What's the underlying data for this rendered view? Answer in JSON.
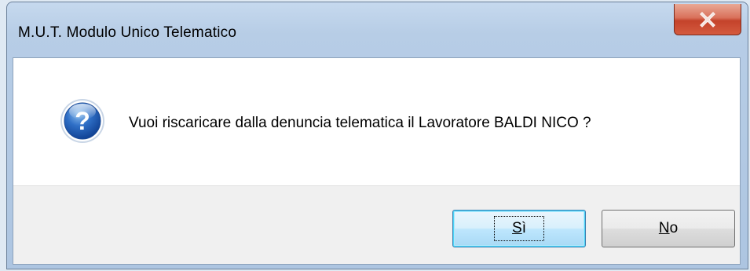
{
  "window": {
    "title": "M.U.T. Modulo Unico Telematico"
  },
  "message": {
    "text": "Vuoi riscaricare dalla denuncia telematica il Lavoratore BALDI NICO ?",
    "icon": "question-icon"
  },
  "buttons": {
    "yes": {
      "mnemonic": "S",
      "rest": "ì"
    },
    "no": {
      "mnemonic": "N",
      "rest": "o"
    }
  },
  "colors": {
    "close_button": "#c4432b",
    "default_button_border": "#3c7fb1",
    "footer_background": "#f0f0f0"
  }
}
